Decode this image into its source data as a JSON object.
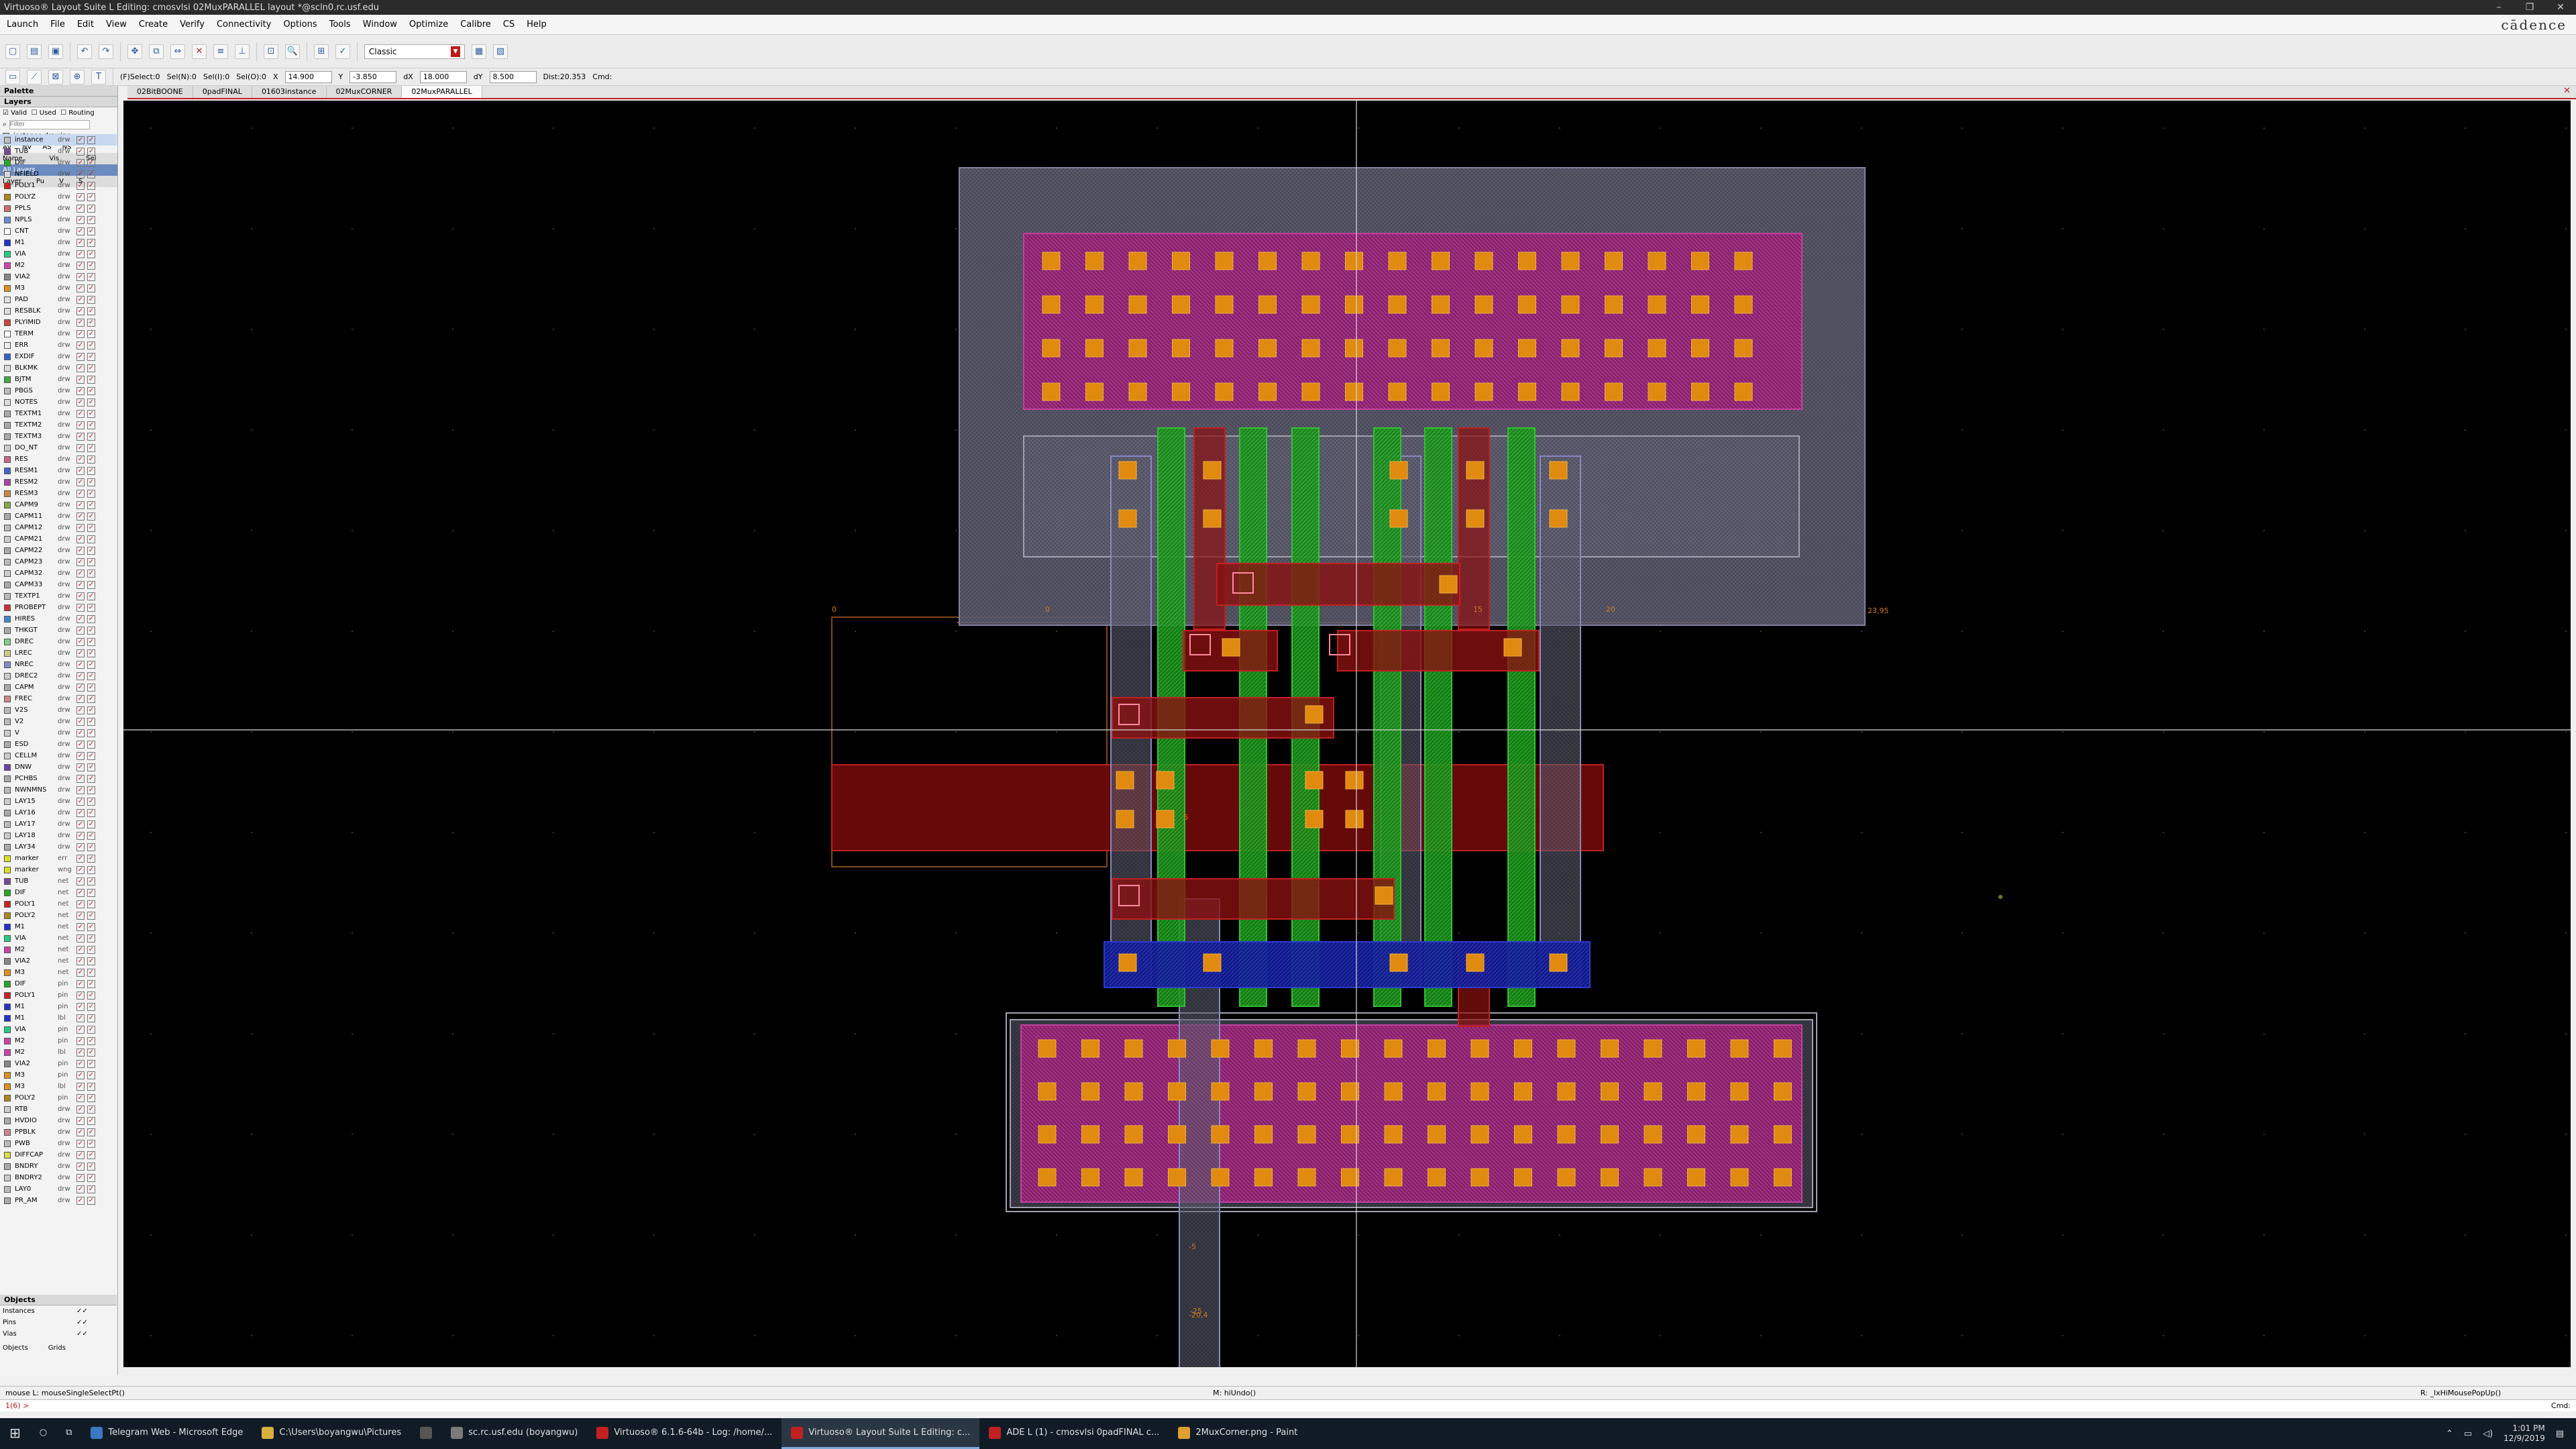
{
  "window": {
    "title": "Virtuoso® Layout Suite L Editing: cmosvlsi 02MuxPARALLEL layout *@scln0.rc.usf.edu",
    "controls": [
      "–",
      "❐",
      "✕"
    ]
  },
  "menu": [
    "Launch",
    "File",
    "Edit",
    "View",
    "Create",
    "Verify",
    "Connectivity",
    "Options",
    "Tools",
    "Window",
    "Optimize",
    "Calibre",
    "CS",
    "Help"
  ],
  "brand": "cādence",
  "toolbar": {
    "mode": "Classic"
  },
  "toolbar2": {
    "select": "(F)Select:0",
    "sel_n": "Sel(N):0",
    "sel_i": "Sel(I):0",
    "sel_o": "Sel(O):0",
    "x_label": "X",
    "x": "14.900",
    "y_label": "Y",
    "y": "-3.850",
    "dx_label": "dX",
    "dx": "18.000",
    "dy_label": "dY",
    "dy": "8.500",
    "dist": "Dist:20.353",
    "cmd": "Cmd:"
  },
  "tabs": [
    "02BitBOONE",
    "0padFINAL",
    "01603instance",
    "02MuxCORNER",
    "02MuxPARALLEL"
  ],
  "palette": {
    "title": "Palette",
    "layers_title": "Layers",
    "valid": "Valid",
    "used": "Used",
    "routing": "Routing",
    "filter_placeholder": "Filter",
    "current_layer": "instance drawing",
    "av": "AV",
    "nv": "NV",
    "as": "AS",
    "ns": "NS",
    "name_col": "Name",
    "vis_col": "Vis",
    "sel_col": "Sel",
    "all_layers": "All Layers",
    "layer_col": "Layer",
    "pu_col": "Pu",
    "v_col": "V",
    "s_col": "S",
    "layers": [
      {
        "n": "instance",
        "p": "drw",
        "c": "#c0c0c0"
      },
      {
        "n": "TUB",
        "p": "drw",
        "c": "#7a4a9a"
      },
      {
        "n": "DIF",
        "p": "drw",
        "c": "#22aa22"
      },
      {
        "n": "NFIELD",
        "p": "drw",
        "c": "#d8d8d8"
      },
      {
        "n": "POLY1",
        "p": "drw",
        "c": "#cc2222"
      },
      {
        "n": "POLYZ",
        "p": "drw",
        "c": "#aa8822"
      },
      {
        "n": "PPLS",
        "p": "drw",
        "c": "#d46a6a"
      },
      {
        "n": "NPLS",
        "p": "drw",
        "c": "#6a8ad4"
      },
      {
        "n": "CNT",
        "p": "drw",
        "c": "#ffffff"
      },
      {
        "n": "M1",
        "p": "drw",
        "c": "#2233cc"
      },
      {
        "n": "VIA",
        "p": "drw",
        "c": "#22cc88"
      },
      {
        "n": "M2",
        "p": "drw",
        "c": "#cc44aa"
      },
      {
        "n": "VIA2",
        "p": "drw",
        "c": "#888888"
      },
      {
        "n": "M3",
        "p": "drw",
        "c": "#e09020"
      },
      {
        "n": "PAD",
        "p": "drw",
        "c": "#e0e0e0"
      },
      {
        "n": "RESBLK",
        "p": "drw",
        "c": "#dddddd"
      },
      {
        "n": "PLYIMID",
        "p": "drw",
        "c": "#cc4444"
      },
      {
        "n": "TERM",
        "p": "drw",
        "c": "#ffffff"
      },
      {
        "n": "ERR",
        "p": "drw",
        "c": "#eeeeee"
      },
      {
        "n": "EXDIF",
        "p": "drw",
        "c": "#3366cc"
      },
      {
        "n": "BLKMK",
        "p": "drw",
        "c": "#dddddd"
      },
      {
        "n": "BJTM",
        "p": "drw",
        "c": "#44aa44"
      },
      {
        "n": "PBGS",
        "p": "drw",
        "c": "#bbbbbb"
      },
      {
        "n": "NOTES",
        "p": "drw",
        "c": "#dddddd"
      },
      {
        "n": "TEXTM1",
        "p": "drw",
        "c": "#aaaaaa"
      },
      {
        "n": "TEXTM2",
        "p": "drw",
        "c": "#aaaaaa"
      },
      {
        "n": "TEXTM3",
        "p": "drw",
        "c": "#aaaaaa"
      },
      {
        "n": "DO_NT",
        "p": "drw",
        "c": "#cccccc"
      },
      {
        "n": "RES",
        "p": "drw",
        "c": "#cc6688"
      },
      {
        "n": "RESM1",
        "p": "drw",
        "c": "#4466cc"
      },
      {
        "n": "RESM2",
        "p": "drw",
        "c": "#aa44aa"
      },
      {
        "n": "RESM3",
        "p": "drw",
        "c": "#cc8844"
      },
      {
        "n": "CAPM9",
        "p": "drw",
        "c": "#88aa44"
      },
      {
        "n": "CAPM11",
        "p": "drw",
        "c": "#aaaaaa"
      },
      {
        "n": "CAPM12",
        "p": "drw",
        "c": "#bbbbbb"
      },
      {
        "n": "CAPM21",
        "p": "drw",
        "c": "#cccccc"
      },
      {
        "n": "CAPM22",
        "p": "drw",
        "c": "#aaaaaa"
      },
      {
        "n": "CAPM23",
        "p": "drw",
        "c": "#bbbbbb"
      },
      {
        "n": "CAPM32",
        "p": "drw",
        "c": "#cccccc"
      },
      {
        "n": "CAPM33",
        "p": "drw",
        "c": "#aaaaaa"
      },
      {
        "n": "TEXTP1",
        "p": "drw",
        "c": "#bbbbbb"
      },
      {
        "n": "PROBEPT",
        "p": "drw",
        "c": "#cc3333"
      },
      {
        "n": "HIRES",
        "p": "drw",
        "c": "#4488cc"
      },
      {
        "n": "THKGT",
        "p": "drw",
        "c": "#aaaaaa"
      },
      {
        "n": "DREC",
        "p": "drw",
        "c": "#88cc88"
      },
      {
        "n": "LREC",
        "p": "drw",
        "c": "#cccc88"
      },
      {
        "n": "NREC",
        "p": "drw",
        "c": "#8888cc"
      },
      {
        "n": "DREC2",
        "p": "drw",
        "c": "#cccccc"
      },
      {
        "n": "CAPM",
        "p": "drw",
        "c": "#aaaaaa"
      },
      {
        "n": "FREC",
        "p": "drw",
        "c": "#cc8888"
      },
      {
        "n": "V2S",
        "p": "drw",
        "c": "#bbbbbb"
      },
      {
        "n": "V2",
        "p": "drw",
        "c": "#bbbbbb"
      },
      {
        "n": "V",
        "p": "drw",
        "c": "#cccccc"
      },
      {
        "n": "ESD",
        "p": "drw",
        "c": "#aaaaaa"
      },
      {
        "n": "CELLM",
        "p": "drw",
        "c": "#cccccc"
      },
      {
        "n": "DNW",
        "p": "drw",
        "c": "#6644aa"
      },
      {
        "n": "PCHBS",
        "p": "drw",
        "c": "#aaaaaa"
      },
      {
        "n": "NWNMNS",
        "p": "drw",
        "c": "#bbbbbb"
      },
      {
        "n": "LAY15",
        "p": "drw",
        "c": "#cccccc"
      },
      {
        "n": "LAY16",
        "p": "drw",
        "c": "#aaaaaa"
      },
      {
        "n": "LAY17",
        "p": "drw",
        "c": "#bbbbbb"
      },
      {
        "n": "LAY18",
        "p": "drw",
        "c": "#cccccc"
      },
      {
        "n": "LAY34",
        "p": "drw",
        "c": "#aaaaaa"
      },
      {
        "n": "marker",
        "p": "err",
        "c": "#dddd22"
      },
      {
        "n": "marker",
        "p": "wng",
        "c": "#dddd22"
      },
      {
        "n": "TUB",
        "p": "net",
        "c": "#7a4a9a"
      },
      {
        "n": "DIF",
        "p": "net",
        "c": "#22aa22"
      },
      {
        "n": "POLY1",
        "p": "net",
        "c": "#cc2222"
      },
      {
        "n": "POLY2",
        "p": "net",
        "c": "#aa8822"
      },
      {
        "n": "M1",
        "p": "net",
        "c": "#2233cc"
      },
      {
        "n": "VIA",
        "p": "net",
        "c": "#22cc88"
      },
      {
        "n": "M2",
        "p": "net",
        "c": "#cc44aa"
      },
      {
        "n": "VIA2",
        "p": "net",
        "c": "#888888"
      },
      {
        "n": "M3",
        "p": "net",
        "c": "#e09020"
      },
      {
        "n": "DIF",
        "p": "pin",
        "c": "#22aa22"
      },
      {
        "n": "POLY1",
        "p": "pin",
        "c": "#cc2222"
      },
      {
        "n": "M1",
        "p": "pin",
        "c": "#2233cc"
      },
      {
        "n": "M1",
        "p": "lbl",
        "c": "#2233cc"
      },
      {
        "n": "VIA",
        "p": "pin",
        "c": "#22cc88"
      },
      {
        "n": "M2",
        "p": "pin",
        "c": "#cc44aa"
      },
      {
        "n": "M2",
        "p": "lbl",
        "c": "#cc44aa"
      },
      {
        "n": "VIA2",
        "p": "pin",
        "c": "#888888"
      },
      {
        "n": "M3",
        "p": "pin",
        "c": "#e09020"
      },
      {
        "n": "M3",
        "p": "lbl",
        "c": "#e09020"
      },
      {
        "n": "POLY2",
        "p": "pin",
        "c": "#aa8822"
      },
      {
        "n": "RTB",
        "p": "drw",
        "c": "#cccccc"
      },
      {
        "n": "HVDIO",
        "p": "drw",
        "c": "#aaaaaa"
      },
      {
        "n": "PPBLK",
        "p": "drw",
        "c": "#cc8888"
      },
      {
        "n": "PWB",
        "p": "drw",
        "c": "#bbbbbb"
      },
      {
        "n": "DIFFCAP",
        "p": "drw",
        "c": "#dddd44"
      },
      {
        "n": "BNDRY",
        "p": "drw",
        "c": "#aaaaaa"
      },
      {
        "n": "BNDRY2",
        "p": "drw",
        "c": "#cccccc"
      },
      {
        "n": "LAY0",
        "p": "drw",
        "c": "#bbbbbb"
      },
      {
        "n": "PR_AM",
        "p": "drw",
        "c": "#aaaaaa"
      }
    ],
    "objects_title": "Objects",
    "objects": [
      "Instances",
      "Pins",
      "Vias"
    ],
    "bottom_tabs": [
      "Objects",
      "Grids"
    ]
  },
  "canvas_labels": [
    "0",
    "0",
    "6",
    "15",
    "20",
    "23,95",
    "-5",
    "-25",
    "-20,4"
  ],
  "status": {
    "left": "mouse L: mouseSingleSelectPt()",
    "mid": "M: hiUndo()",
    "right": "R: _lxHiMousePopUp()",
    "prompt": "1(6)  >",
    "cmd": "Cmd:"
  },
  "taskbar": {
    "items": [
      "Telegram Web - Microsoft Edge",
      "C:\\Users\\boyangwu\\Pictures",
      "sc.rc.usf.edu (boyangwu)",
      "Virtuoso® 6.1.6-64b - Log: /home/...",
      "Virtuoso® Layout Suite L Editing: c...",
      "ADE L (1) - cmosvlsi 0padFINAL c...",
      "2MuxCorner.png - Paint"
    ],
    "time": "1:01 PM",
    "date": "12/9/2019"
  },
  "layout_colors": {
    "poly": "#c41a1a",
    "diffusion": "#22c022",
    "metal1": "#1a2bd0",
    "metal2": "#d03aa8",
    "via": "#e09020",
    "well": "#8080a0"
  }
}
